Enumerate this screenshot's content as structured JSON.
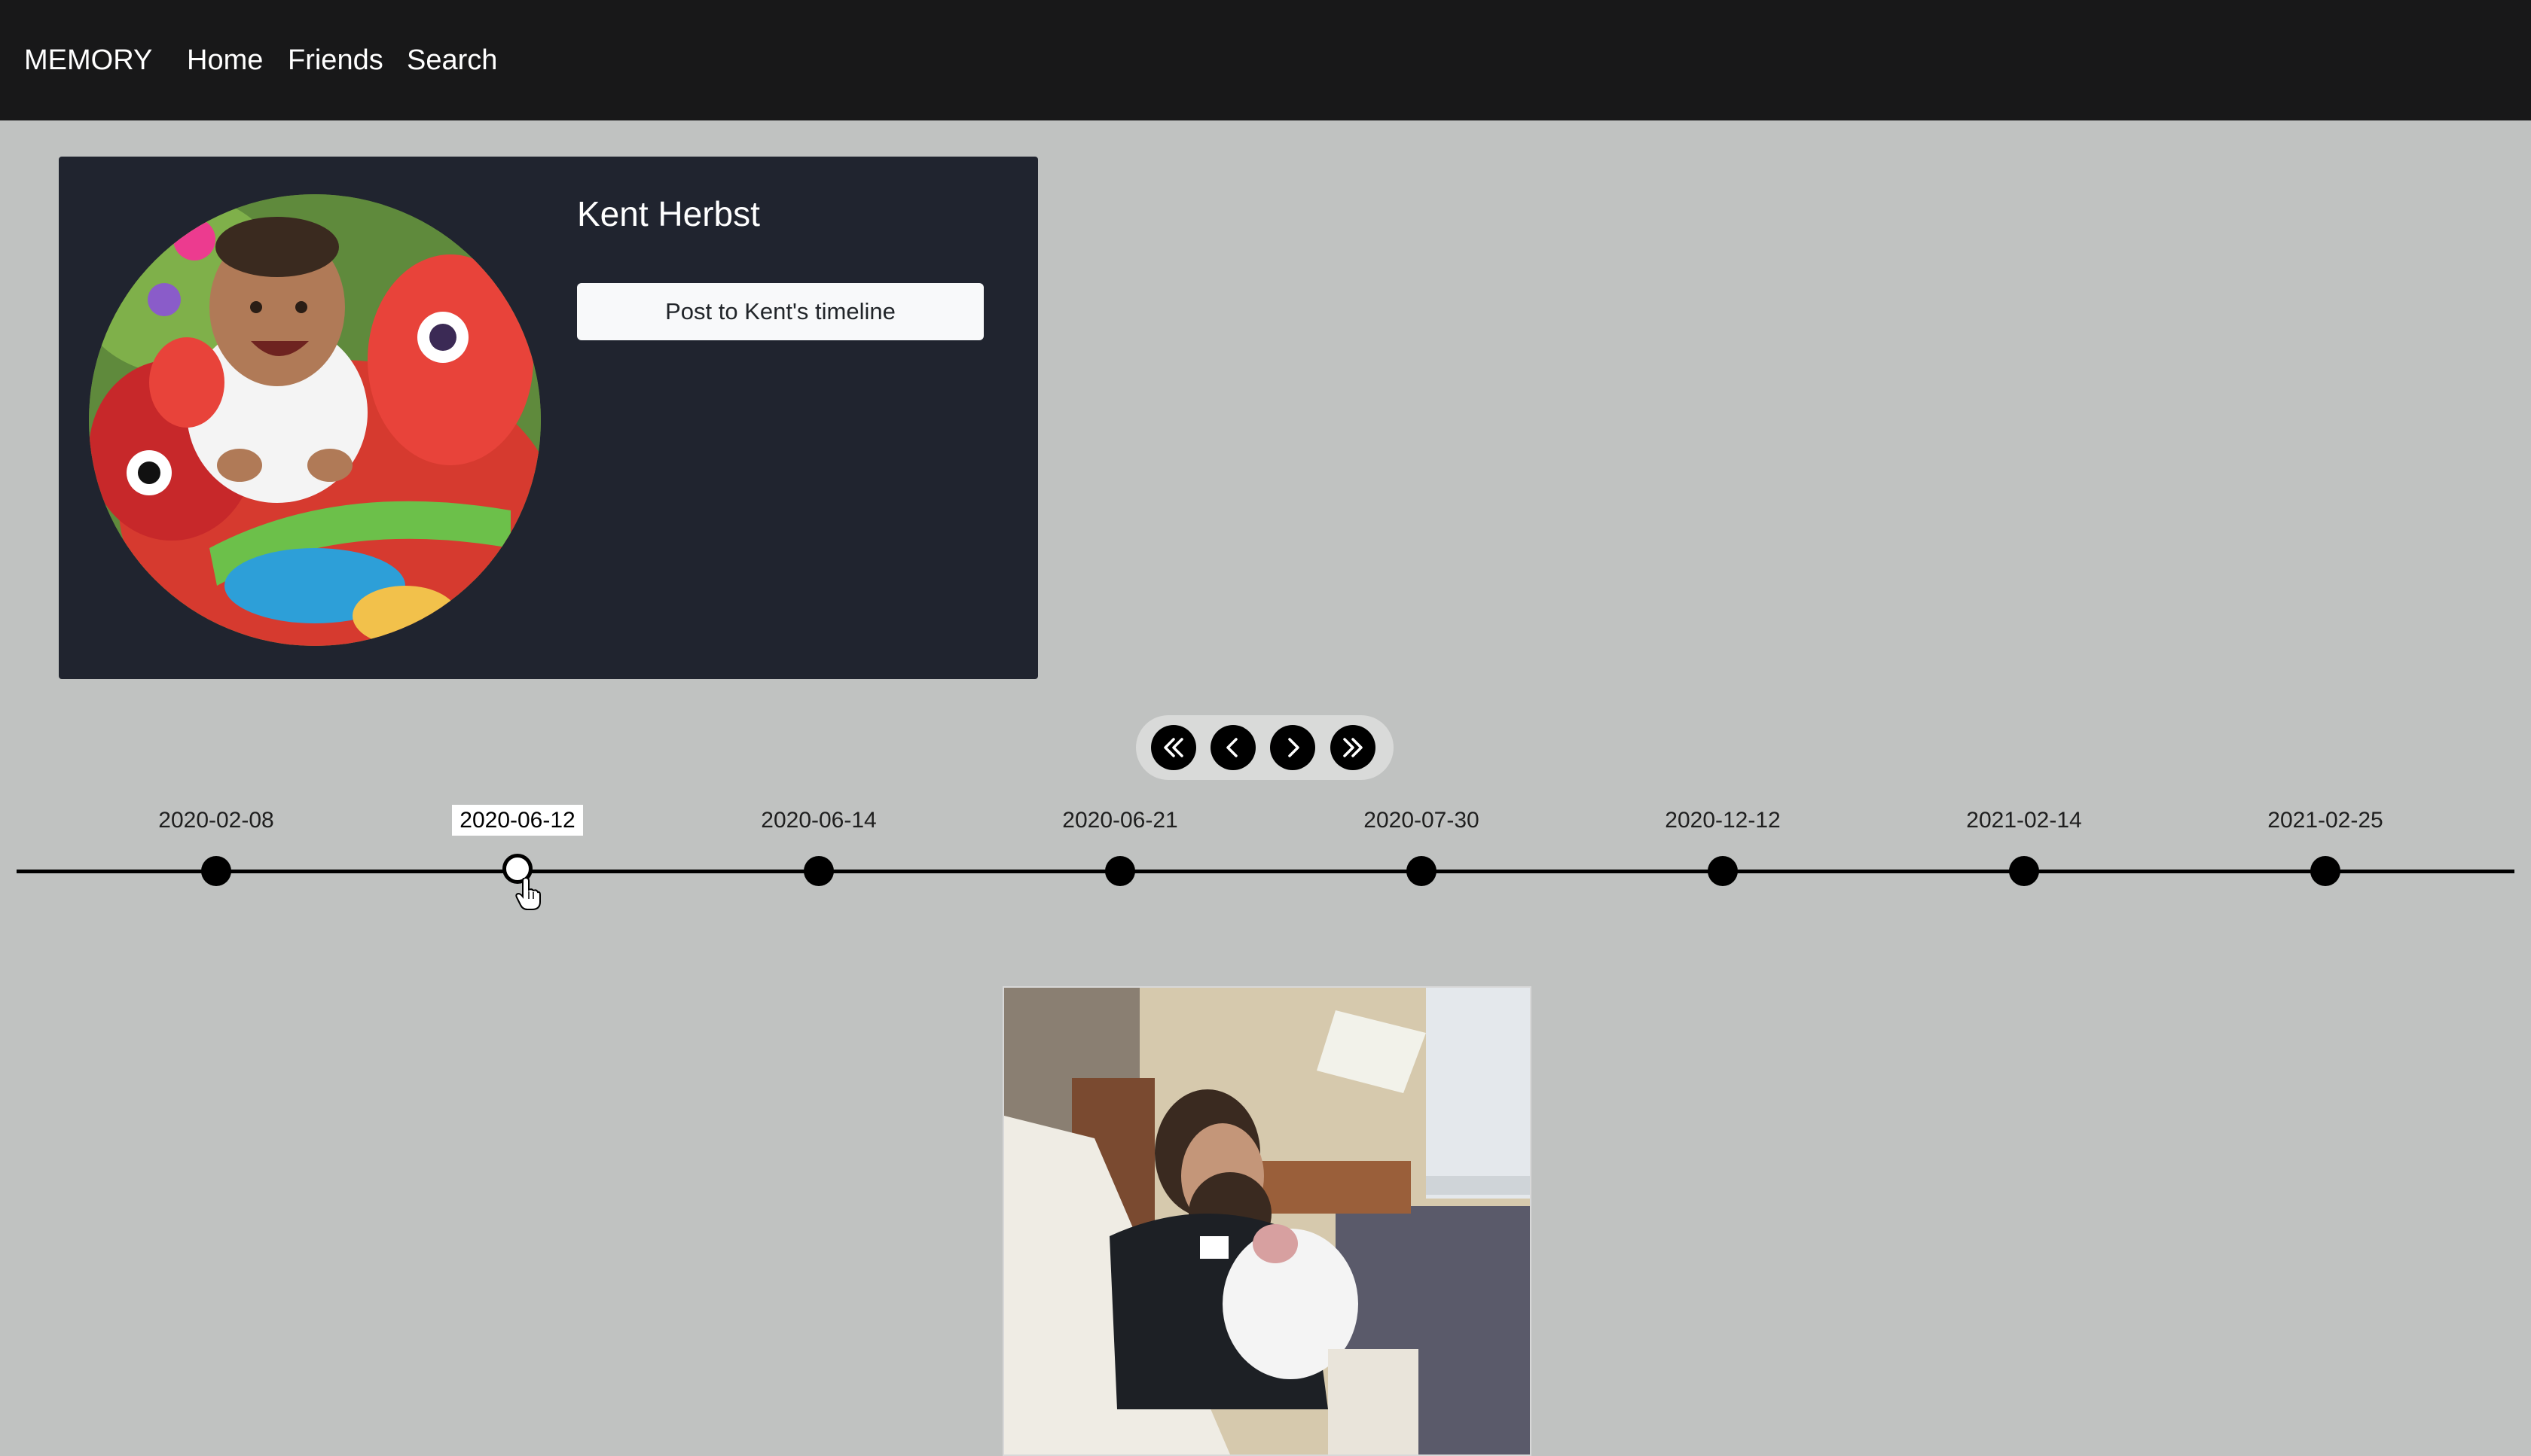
{
  "nav": {
    "brand": "MEMORY",
    "links": [
      "Home",
      "Friends",
      "Search"
    ]
  },
  "profile": {
    "name": "Kent Herbst",
    "post_button_label": "Post to Kent's timeline"
  },
  "controls": {
    "icons": [
      "double-chevron-left-icon",
      "chevron-left-icon",
      "chevron-right-icon",
      "double-chevron-right-icon"
    ]
  },
  "timeline": {
    "dates": [
      "2020-02-08",
      "2020-06-12",
      "2020-06-14",
      "2020-06-21",
      "2020-07-30",
      "2020-12-12",
      "2021-02-14",
      "2021-02-25"
    ],
    "selected_index": 1
  },
  "colors": {
    "navbar": "#181819",
    "page_bg": "#c0c2c1",
    "card_bg": "#20242f"
  }
}
